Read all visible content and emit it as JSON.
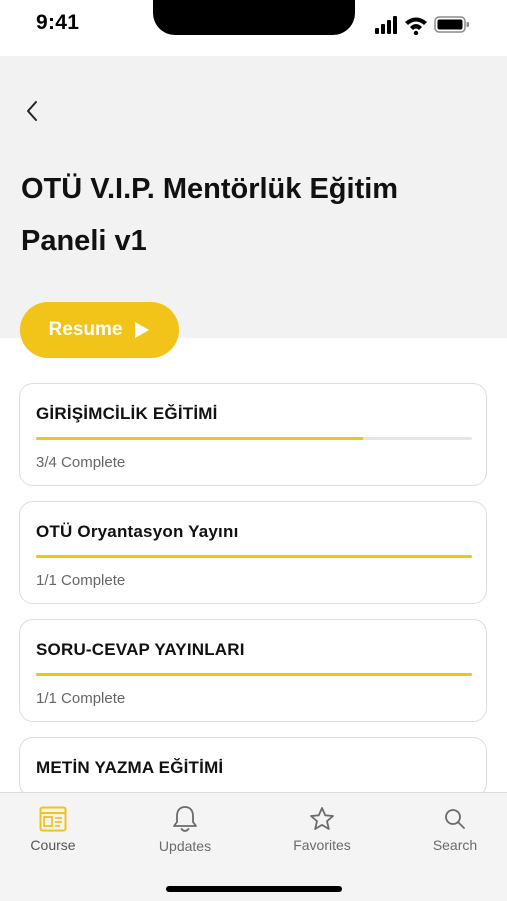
{
  "status_bar": {
    "time": "9:41"
  },
  "header": {
    "title": "OTÜ V.I.P. Mentörlük Eğitim Paneli v1"
  },
  "resume": {
    "label": "Resume"
  },
  "sections": [
    {
      "title": "GİRİŞİMCİLİK EĞİTİMİ",
      "progress": "3/4 Complete",
      "fraction": 0.75
    },
    {
      "title": "OTÜ Oryantasyon Yayını",
      "progress": "1/1 Complete",
      "fraction": 1.0
    },
    {
      "title": "SORU-CEVAP YAYINLARI",
      "progress": "1/1 Complete",
      "fraction": 1.0
    },
    {
      "title": "METİN YAZMA EĞİTİMİ"
    }
  ],
  "tabs": [
    {
      "label": "Course",
      "icon": "course-icon",
      "active": true
    },
    {
      "label": "Updates",
      "icon": "bell-icon",
      "active": false
    },
    {
      "label": "Favorites",
      "icon": "star-icon",
      "active": false
    },
    {
      "label": "Search",
      "icon": "search-icon",
      "active": false
    }
  ],
  "colors": {
    "accent": "#f2c318",
    "header_bg": "#f2f2f2",
    "tab_bar_bg": "#f4f4f4"
  }
}
